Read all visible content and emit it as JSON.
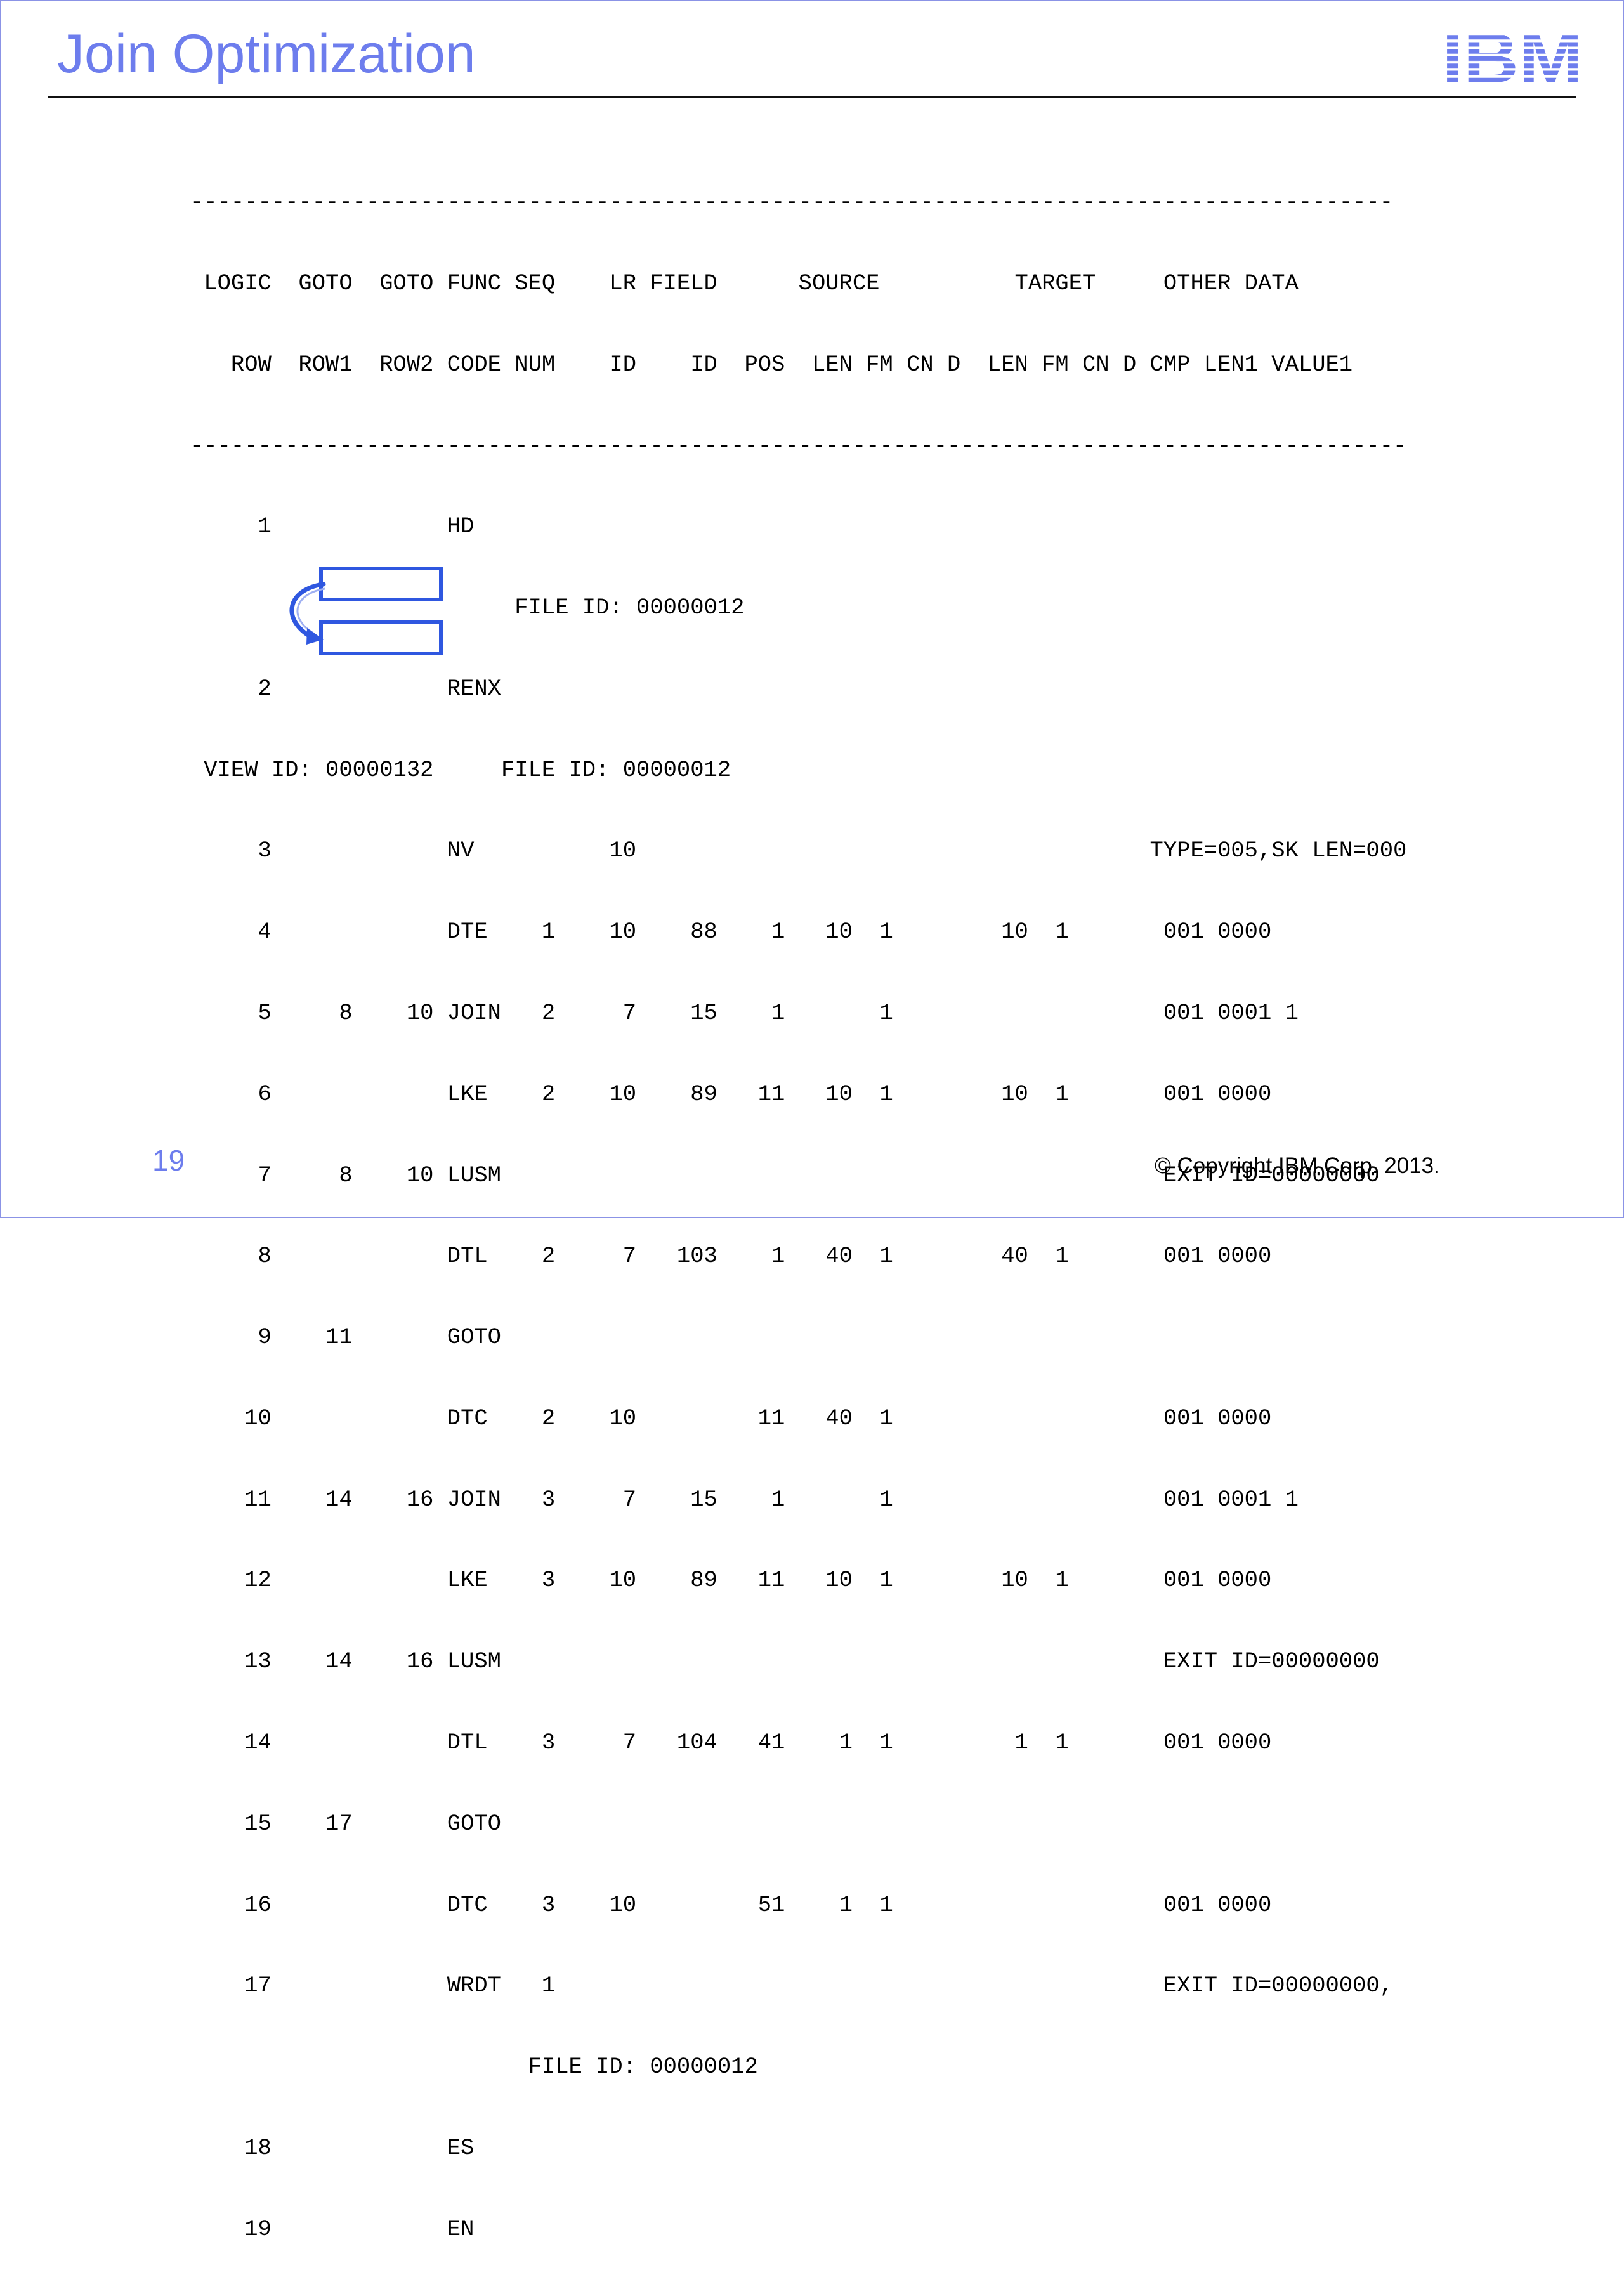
{
  "slide": {
    "title": "Join Optimization",
    "page_number": "19",
    "copyright": "© Copyright IBM Corp. 2013.",
    "logo_text": "IBM",
    "colors": {
      "title": "#6d7ded",
      "logo": "#6d7ded",
      "highlight": "#2f57e0",
      "border": "#8b93e6"
    }
  },
  "listing": {
    "lines": [
      "-----------------------------------------------------------------------------------------",
      " LOGIC  GOTO  GOTO FUNC SEQ    LR FIELD      SOURCE          TARGET     OTHER DATA",
      "   ROW  ROW1  ROW2 CODE NUM    ID    ID  POS  LEN FM CN D  LEN FM CN D CMP LEN1 VALUE1",
      "------------------------------------------------------------------------------------------",
      "     1             HD",
      "                        FILE ID: 00000012",
      "     2             RENX",
      " VIEW ID: 00000132     FILE ID: 00000012",
      "     3             NV          10                                      TYPE=005,SK LEN=000",
      "     4             DTE    1    10    88    1   10  1        10  1       001 0000",
      "     5     8    10 JOIN   2     7    15    1       1                    001 0001 1",
      "     6             LKE    2    10    89   11   10  1        10  1       001 0000",
      "     7     8    10 LUSM                                                 EXIT ID=00000000",
      "     8             DTL    2     7   103    1   40  1        40  1       001 0000",
      "     9    11       GOTO",
      "    10             DTC    2    10         11   40  1                    001 0000",
      "    11    14    16 JOIN   3     7    15    1       1                    001 0001 1",
      "    12             LKE    3    10    89   11   10  1        10  1       001 0000",
      "    13    14    16 LUSM                                                 EXIT ID=00000000",
      "    14             DTL    3     7   104   41    1  1         1  1       001 0000",
      "    15    17       GOTO",
      "    16             DTC    3    10         51    1  1                    001 0000",
      "    17             WRDT   1                                             EXIT ID=00000000,",
      "                         FILE ID: 00000012",
      "    18             ES",
      "    19             EN"
    ]
  }
}
